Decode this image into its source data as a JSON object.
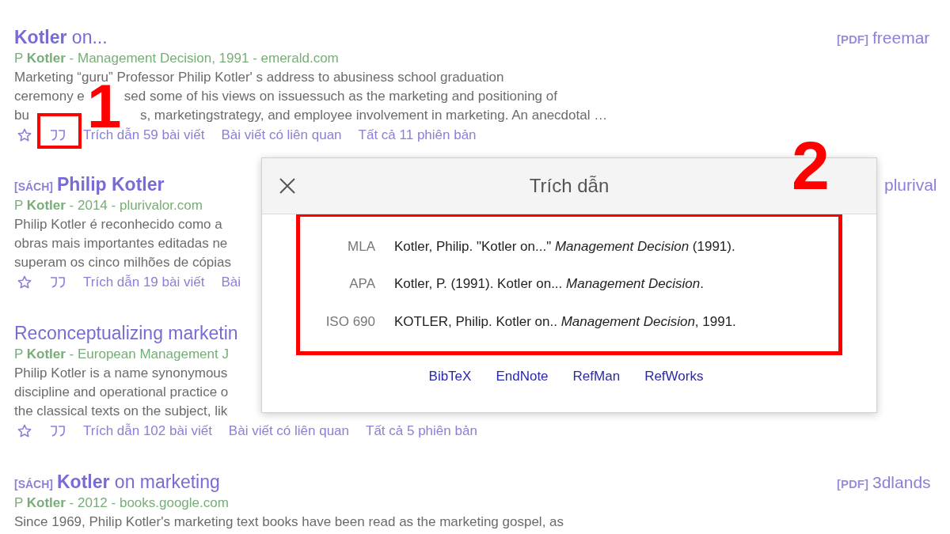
{
  "results": [
    {
      "title": "**Kotler** on...",
      "meta": "P **Kotler** - Management Decision, 1991 - emerald.com",
      "snippet": [
        "Marketing “guru” Professor Philip Kotler' s address to abusiness school graduation",
        [
          "ceremony e",
          "sed some of his views on issuessuch as the marketing and positioning of"
        ],
        [
          "bu",
          "s, marketingstrategy, and employee involvement in marketing. An anecdotal …"
        ]
      ],
      "actions": [
        {
          "kind": "star"
        },
        {
          "kind": "cite",
          "highlighted": true
        },
        {
          "kind": "link",
          "text": "Trích dẫn 59 bài viết"
        },
        {
          "kind": "link",
          "text": "Bài viết có liên quan"
        },
        {
          "kind": "link",
          "text": "Tất cả 11 phiên bản"
        }
      ],
      "side": {
        "tag": "[PDF]",
        "text": "freemar"
      }
    },
    {
      "tag": "[SÁCH]",
      "title": "**Philip Kotler**",
      "meta": "P **Kotler** - 2014 - plurivalor.com",
      "snippet": [
        "Philip Kotler é reconhecido como a",
        "obras mais importantes editadas ne",
        "superam os cinco milhões de cópias"
      ],
      "actions": [
        {
          "kind": "star"
        },
        {
          "kind": "cite",
          "highlighted": false
        },
        {
          "kind": "link",
          "text": "Trích dẫn 19 bài viết"
        },
        {
          "kind": "link",
          "text": "Bài"
        }
      ],
      "side": {
        "text": "plurival"
      }
    },
    {
      "title": "Reconceptualizing marketin",
      "meta": "P **Kotler** - European Management J",
      "snippet": [
        "Philip Kotler is a name synonymous",
        "discipline and operational practice o",
        "the classical texts on the subject, lik"
      ],
      "actions": [
        {
          "kind": "star"
        },
        {
          "kind": "cite",
          "highlighted": false
        },
        {
          "kind": "link",
          "text": "Trích dẫn 102 bài viết"
        },
        {
          "kind": "link",
          "text": "Bài viết có liên quan"
        },
        {
          "kind": "link",
          "text": "Tất cả 5 phiên bản"
        }
      ]
    },
    {
      "tag": "[SÁCH]",
      "title": "**Kotler** on marketing",
      "meta": "P **Kotler** - 2012 - books.google.com",
      "snippet": [
        "Since 1969, Philip Kotler's marketing text books have been read as the marketing gospel, as"
      ],
      "side": {
        "tag": "[PDF]",
        "text": "3dlands"
      }
    }
  ],
  "dialog": {
    "title": "Trích dẫn",
    "highlighted": true,
    "citations": [
      {
        "style": "MLA",
        "text": "Kotler, Philip. \"Kotler on...\" *Management Decision* (1991)."
      },
      {
        "style": "APA",
        "text": "Kotler, P. (1991). Kotler on... *Management Decision*."
      },
      {
        "style": "ISO 690",
        "text": "KOTLER, Philip. Kotler on.. *Management Decision*, 1991."
      }
    ],
    "links": [
      "BibTeX",
      "EndNote",
      "RefMan",
      "RefWorks"
    ]
  },
  "annotations": [
    "1",
    "2"
  ]
}
